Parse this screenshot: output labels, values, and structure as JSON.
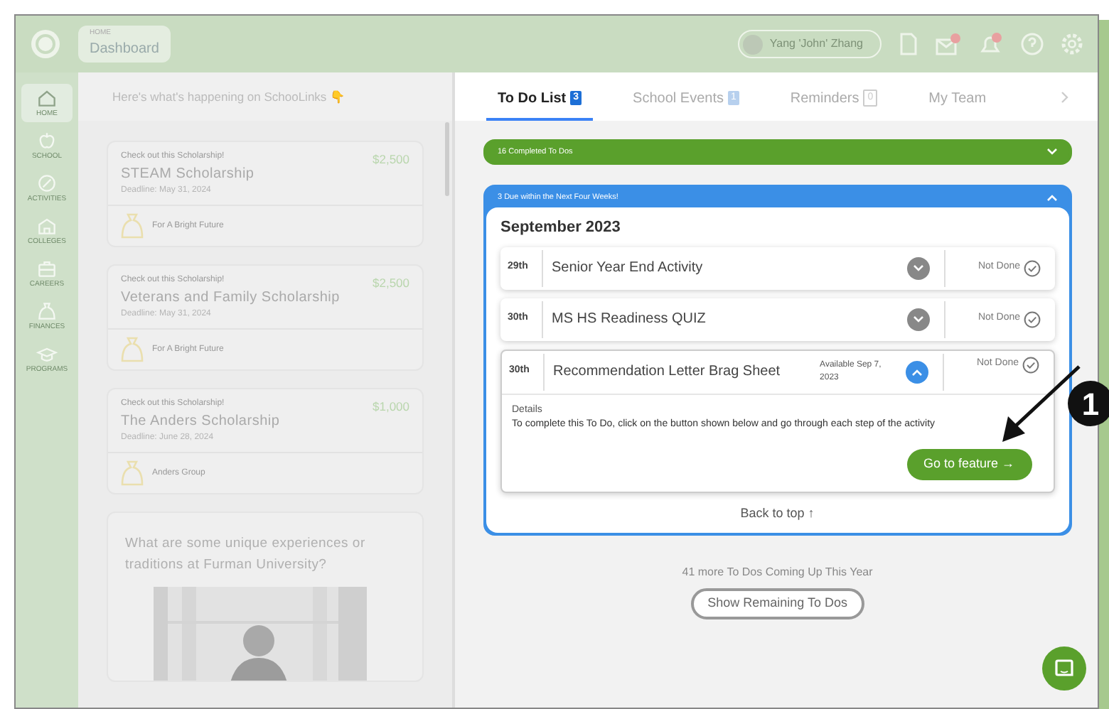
{
  "top_bar": {
    "breadcrumb_label": "HOME",
    "page_title": "Dashboard",
    "user_name": "Yang 'John' Zhang"
  },
  "sidebar": {
    "items": [
      {
        "label": "HOME",
        "selected": true
      },
      {
        "label": "SCHOOL",
        "selected": false
      },
      {
        "label": "ACTIVITIES",
        "selected": false
      },
      {
        "label": "COLLEGES",
        "selected": false
      },
      {
        "label": "CAREERS",
        "selected": false
      },
      {
        "label": "FINANCES",
        "selected": false
      },
      {
        "label": "PROGRAMS",
        "selected": false
      }
    ]
  },
  "feed": {
    "heading": "Here's what's happening on SchooLinks 👇",
    "cards": [
      {
        "kind": "scholarship",
        "eyebrow": "Check out this Scholarship!",
        "title": "STEAM Scholarship",
        "amount": "$2,500",
        "deadline": "Deadline: May 31, 2024",
        "sponsor": "For A Bright Future"
      },
      {
        "kind": "scholarship",
        "eyebrow": "Check out this Scholarship!",
        "title": "Veterans and Family Scholarship",
        "amount": "$2,500",
        "deadline": "Deadline: May 31, 2024",
        "sponsor": "For A Bright Future"
      },
      {
        "kind": "scholarship",
        "eyebrow": "Check out this Scholarship!",
        "title": "The Anders Scholarship",
        "amount": "$1,000",
        "deadline": "Deadline: June 28, 2024",
        "sponsor": "Anders Group"
      },
      {
        "kind": "question",
        "title": "What are some unique experiences or traditions at Furman University?"
      }
    ]
  },
  "tabs": [
    {
      "label": "To Do List",
      "count": "3",
      "selected": true
    },
    {
      "label": "School Events",
      "count": "1",
      "selected": false
    },
    {
      "label": "Reminders",
      "count": "0",
      "selected": false
    },
    {
      "label": "My Team",
      "selected": false
    }
  ],
  "sections": [
    {
      "title": "16 Completed To Dos",
      "kind": "completed",
      "expanded": false
    },
    {
      "title": "3 Due within the Next Four Weeks!",
      "kind": "due",
      "expanded": true,
      "month": "September 2023",
      "todos": [
        {
          "day": "29th",
          "title": "Senior Year End Activity",
          "status": "Not Done",
          "expanded": false
        },
        {
          "day": "30th",
          "title": "MS HS Readiness QUIZ",
          "status": "Not Done",
          "expanded": false
        },
        {
          "day": "30th",
          "title": "Recommendation Letter Brag Sheet",
          "available": "Available Sep 7, 2023",
          "status": "Not Done",
          "expanded": true,
          "details_label": "Details",
          "details": "To complete this To Do, click on the button shown below and go through each step of the activity",
          "action": "Go to feature →"
        }
      ],
      "back_to_top": "Back to top ↑"
    }
  ],
  "more_text": "41 more To Dos Coming Up This Year",
  "show_button": "Show Remaining To Dos",
  "callout": {
    "number": "1"
  }
}
